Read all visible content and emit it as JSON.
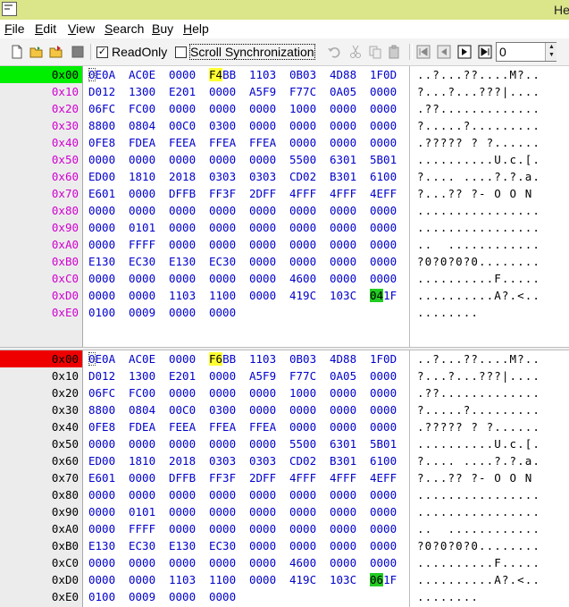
{
  "window": {
    "title": "He"
  },
  "menu": [
    {
      "mnemonic": "F",
      "rest": "ile"
    },
    {
      "mnemonic": "E",
      "rest": "dit"
    },
    {
      "mnemonic": "V",
      "rest": "iew"
    },
    {
      "mnemonic": "S",
      "rest": "earch"
    },
    {
      "mnemonic": "B",
      "rest": "uy"
    },
    {
      "mnemonic": "H",
      "rest": "elp"
    }
  ],
  "toolbar": {
    "readonly_label": "ReadOnly",
    "readonly_checked": "✓",
    "scroll_sync_label": "Scroll Synchronization",
    "scroll_sync_checked": "",
    "offset_value": "0"
  },
  "colors": {
    "title_bar": "#dbe58a",
    "active_row_top": "#00ee00",
    "active_row_bottom": "#ee0000",
    "hex_text": "#0000cc",
    "addr_magenta": "#d000d0",
    "change_highlight": "#ffff33",
    "match_highlight": "#22cc22"
  },
  "panes": [
    {
      "active_addr_color": "green",
      "rows": [
        {
          "addr": "0x00",
          "hex": [
            "0E0A",
            "AC0E",
            "0000",
            "F4BB",
            "1103",
            "0B03",
            "4D88",
            "1F0D"
          ],
          "ascii": "..?...??....M?.."
        },
        {
          "addr": "0x10",
          "hex": [
            "D012",
            "1300",
            "E201",
            "0000",
            "A5F9",
            "F77C",
            "0A05",
            "0000"
          ],
          "ascii": "?...?...???|...."
        },
        {
          "addr": "0x20",
          "hex": [
            "06FC",
            "FC00",
            "0000",
            "0000",
            "0000",
            "1000",
            "0000",
            "0000"
          ],
          "ascii": ".??............."
        },
        {
          "addr": "0x30",
          "hex": [
            "8800",
            "0804",
            "00C0",
            "0300",
            "0000",
            "0000",
            "0000",
            "0000"
          ],
          "ascii": "?.....?........."
        },
        {
          "addr": "0x40",
          "hex": [
            "0FE8",
            "FDEA",
            "FEEA",
            "FFEA",
            "FFEA",
            "0000",
            "0000",
            "0000"
          ],
          "ascii": ".????? ? ?......"
        },
        {
          "addr": "0x50",
          "hex": [
            "0000",
            "0000",
            "0000",
            "0000",
            "0000",
            "5500",
            "6301",
            "5B01"
          ],
          "ascii": "..........U.c.[."
        },
        {
          "addr": "0x60",
          "hex": [
            "ED00",
            "1810",
            "2018",
            "0303",
            "0303",
            "CD02",
            "B301",
            "6100"
          ],
          "ascii": "?.... ....?.?.a."
        },
        {
          "addr": "0x70",
          "hex": [
            "E601",
            "0000",
            "DFFB",
            "FF3F",
            "2DFF",
            "4FFF",
            "4FFF",
            "4EFF"
          ],
          "ascii": "?...?? ?- O O N "
        },
        {
          "addr": "0x80",
          "hex": [
            "0000",
            "0000",
            "0000",
            "0000",
            "0000",
            "0000",
            "0000",
            "0000"
          ],
          "ascii": "................"
        },
        {
          "addr": "0x90",
          "hex": [
            "0000",
            "0101",
            "0000",
            "0000",
            "0000",
            "0000",
            "0000",
            "0000"
          ],
          "ascii": "................"
        },
        {
          "addr": "0xA0",
          "hex": [
            "0000",
            "FFFF",
            "0000",
            "0000",
            "0000",
            "0000",
            "0000",
            "0000"
          ],
          "ascii": "..  ............"
        },
        {
          "addr": "0xB0",
          "hex": [
            "E130",
            "EC30",
            "E130",
            "EC30",
            "0000",
            "0000",
            "0000",
            "0000"
          ],
          "ascii": "?0?0?0?0........"
        },
        {
          "addr": "0xC0",
          "hex": [
            "0000",
            "0000",
            "0000",
            "0000",
            "0000",
            "4600",
            "0000",
            "0000"
          ],
          "ascii": "..........F....."
        },
        {
          "addr": "0xD0",
          "hex": [
            "0000",
            "0000",
            "1103",
            "1100",
            "0000",
            "419C",
            "103C",
            "041F"
          ],
          "ascii": "..........A?.<.."
        },
        {
          "addr": "0xE0",
          "hex": [
            "0100",
            "0009",
            "0000",
            "0000"
          ],
          "ascii": "........"
        }
      ]
    },
    {
      "active_addr_color": "red",
      "rows": [
        {
          "addr": "0x00",
          "hex": [
            "0E0A",
            "AC0E",
            "0000",
            "F6BB",
            "1103",
            "0B03",
            "4D88",
            "1F0D"
          ],
          "ascii": "..?...??....M?.."
        },
        {
          "addr": "0x10",
          "hex": [
            "D012",
            "1300",
            "E201",
            "0000",
            "A5F9",
            "F77C",
            "0A05",
            "0000"
          ],
          "ascii": "?...?...???|...."
        },
        {
          "addr": "0x20",
          "hex": [
            "06FC",
            "FC00",
            "0000",
            "0000",
            "0000",
            "1000",
            "0000",
            "0000"
          ],
          "ascii": ".??............."
        },
        {
          "addr": "0x30",
          "hex": [
            "8800",
            "0804",
            "00C0",
            "0300",
            "0000",
            "0000",
            "0000",
            "0000"
          ],
          "ascii": "?.....?........."
        },
        {
          "addr": "0x40",
          "hex": [
            "0FE8",
            "FDEA",
            "FEEA",
            "FFEA",
            "FFEA",
            "0000",
            "0000",
            "0000"
          ],
          "ascii": ".????? ? ?......"
        },
        {
          "addr": "0x50",
          "hex": [
            "0000",
            "0000",
            "0000",
            "0000",
            "0000",
            "5500",
            "6301",
            "5B01"
          ],
          "ascii": "..........U.c.[."
        },
        {
          "addr": "0x60",
          "hex": [
            "ED00",
            "1810",
            "2018",
            "0303",
            "0303",
            "CD02",
            "B301",
            "6100"
          ],
          "ascii": "?.... ....?.?.a."
        },
        {
          "addr": "0x70",
          "hex": [
            "E601",
            "0000",
            "DFFB",
            "FF3F",
            "2DFF",
            "4FFF",
            "4FFF",
            "4EFF"
          ],
          "ascii": "?...?? ?- O O N "
        },
        {
          "addr": "0x80",
          "hex": [
            "0000",
            "0000",
            "0000",
            "0000",
            "0000",
            "0000",
            "0000",
            "0000"
          ],
          "ascii": "................"
        },
        {
          "addr": "0x90",
          "hex": [
            "0000",
            "0101",
            "0000",
            "0000",
            "0000",
            "0000",
            "0000",
            "0000"
          ],
          "ascii": "................"
        },
        {
          "addr": "0xA0",
          "hex": [
            "0000",
            "FFFF",
            "0000",
            "0000",
            "0000",
            "0000",
            "0000",
            "0000"
          ],
          "ascii": "..  ............"
        },
        {
          "addr": "0xB0",
          "hex": [
            "E130",
            "EC30",
            "E130",
            "EC30",
            "0000",
            "0000",
            "0000",
            "0000"
          ],
          "ascii": "?0?0?0?0........"
        },
        {
          "addr": "0xC0",
          "hex": [
            "0000",
            "0000",
            "0000",
            "0000",
            "0000",
            "4600",
            "0000",
            "0000"
          ],
          "ascii": "..........F....."
        },
        {
          "addr": "0xD0",
          "hex": [
            "0000",
            "0000",
            "1103",
            "1100",
            "0000",
            "419C",
            "103C",
            "061F"
          ],
          "ascii": "..........A?.<.."
        },
        {
          "addr": "0xE0",
          "hex": [
            "0100",
            "0009",
            "0000",
            "0000"
          ],
          "ascii": "........"
        }
      ]
    }
  ]
}
